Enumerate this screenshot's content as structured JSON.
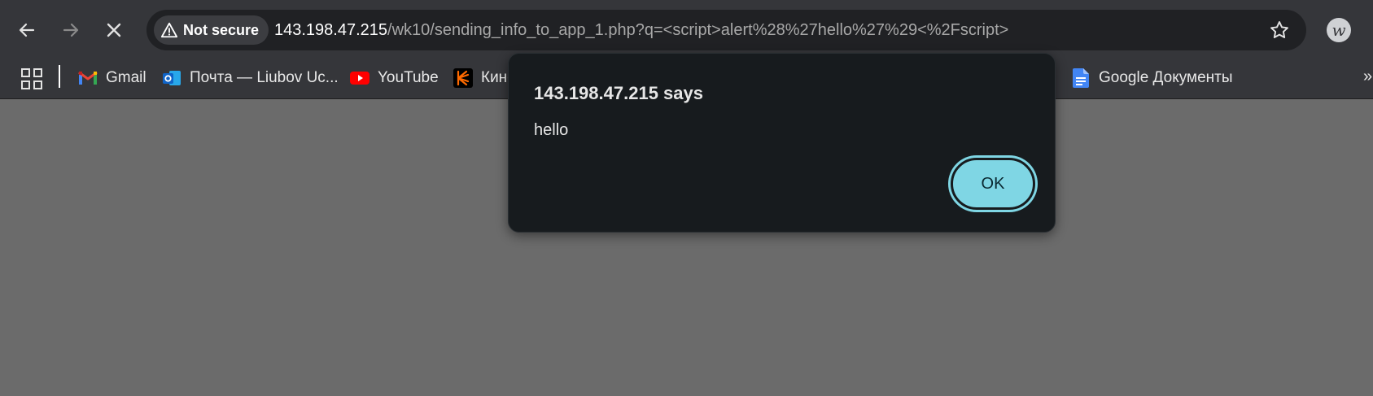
{
  "toolbar": {
    "security_chip": "Not secure",
    "url_host": "143.198.47.215",
    "url_path": "/wk10/sending_info_to_app_1.php?q=<script>alert%28%27hello%27%29<%2Fscript>"
  },
  "bookmarks": [
    {
      "label": "Gmail",
      "icon": "gmail-icon"
    },
    {
      "label": "Почта — Liubov Uc...",
      "icon": "outlook-icon"
    },
    {
      "label": "YouTube",
      "icon": "youtube-icon"
    },
    {
      "label": "Кино",
      "icon": "kinopoisk-icon"
    },
    {
      "label": "Google Документы",
      "icon": "google-docs-icon"
    }
  ],
  "bookmarks_more": "»",
  "extension_letter": "w",
  "dialog": {
    "title": "143.198.47.215 says",
    "message": "hello",
    "ok_label": "OK"
  },
  "colors": {
    "toolbar_bg": "#35363a",
    "omnibox_bg": "#202124",
    "page_overlay": "#6b6b6b",
    "dialog_bg": "#171b1e",
    "ok_button": "#7fd6e4"
  }
}
